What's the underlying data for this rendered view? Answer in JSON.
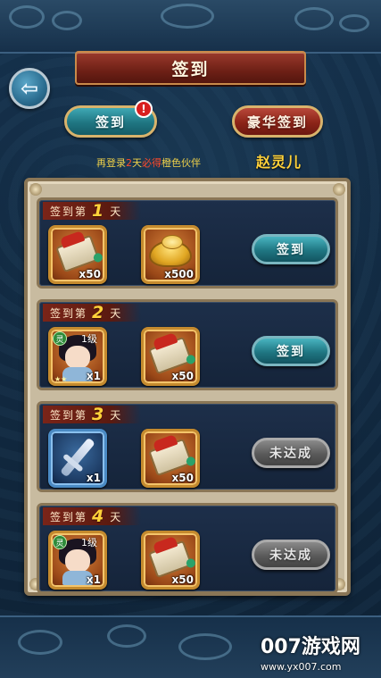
{
  "header": {
    "title": "签到"
  },
  "tabs": [
    {
      "label": "签到",
      "badge": "!"
    },
    {
      "label": "豪华签到"
    }
  ],
  "hint": {
    "prefix": "再登录",
    "count": "2",
    "days": "天",
    "must": "必得",
    "suffix": "橙色伙伴"
  },
  "companion_name": "赵灵儿",
  "rows": [
    {
      "prefix": "签到第",
      "day": "1",
      "suffix": "天",
      "items": [
        {
          "icon": "scroll-icon",
          "qty": "x50"
        },
        {
          "icon": "gold-ingot-icon",
          "qty": "x500"
        }
      ],
      "button": "签到",
      "state": "active"
    },
    {
      "prefix": "签到第",
      "day": "2",
      "suffix": "天",
      "items": [
        {
          "icon": "hero-portrait-icon",
          "qty": "x1",
          "level": "1级",
          "element": "灵"
        },
        {
          "icon": "scroll-icon",
          "qty": "x50"
        }
      ],
      "button": "签到",
      "state": "active"
    },
    {
      "prefix": "签到第",
      "day": "3",
      "suffix": "天",
      "items": [
        {
          "icon": "dart-weapon-icon",
          "qty": "x1"
        },
        {
          "icon": "scroll-icon",
          "qty": "x50"
        }
      ],
      "button": "未达成",
      "state": "disabled"
    },
    {
      "prefix": "签到第",
      "day": "4",
      "suffix": "天",
      "items": [
        {
          "icon": "hero-portrait-icon",
          "qty": "x1",
          "level": "1级",
          "element": "灵"
        },
        {
          "icon": "scroll-icon",
          "qty": "x50"
        }
      ],
      "button": "未达成",
      "state": "disabled"
    }
  ],
  "watermark": {
    "main": "007游戏网",
    "sub": "www.yx007.com"
  },
  "colors": {
    "accent_gold": "#ffd23a",
    "button_teal": "#1f7682",
    "button_red": "#8c2418",
    "hint_red": "#ff4a2a"
  }
}
